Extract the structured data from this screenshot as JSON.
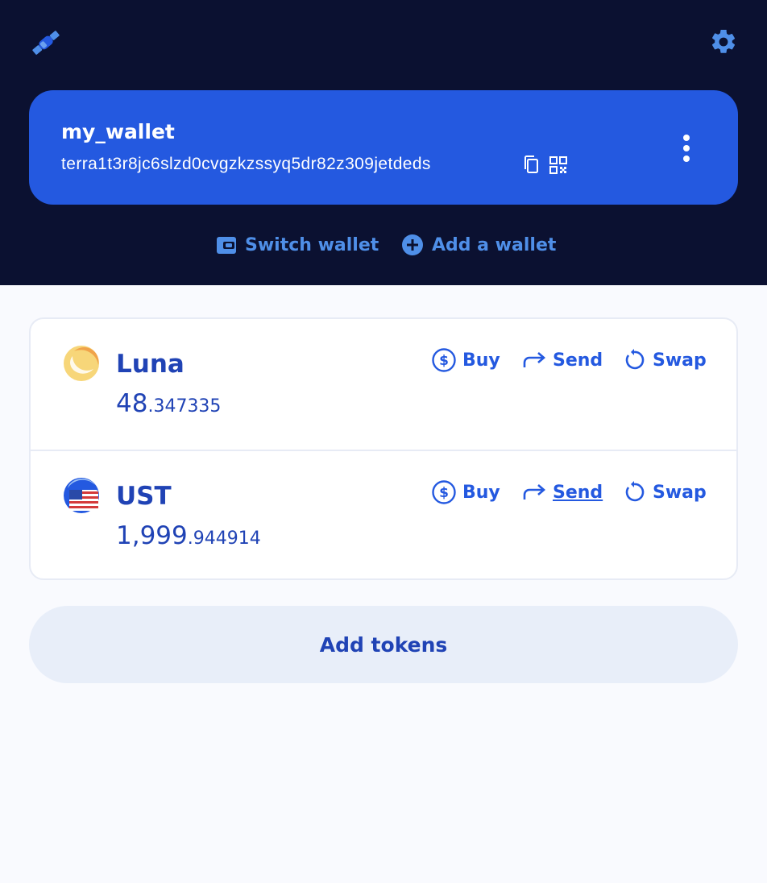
{
  "header": {
    "logo_icon": "satellite-icon",
    "settings_icon": "gear-icon"
  },
  "wallet": {
    "name": "my_wallet",
    "address": "terra1t3r8jc6slzd0cvgzkzssyq5dr82z309jetdeds",
    "actions": {
      "switch_label": "Switch wallet",
      "add_label": "Add a wallet"
    }
  },
  "assets": [
    {
      "symbol": "Luna",
      "amount_int": "48",
      "amount_dec": ".347335",
      "icon": "luna-token-icon",
      "actions": {
        "buy": "Buy",
        "send": "Send",
        "swap": "Swap"
      }
    },
    {
      "symbol": "UST",
      "amount_int": "1,999",
      "amount_dec": ".944914",
      "icon": "ust-token-icon",
      "actions": {
        "buy": "Buy",
        "send": "Send",
        "swap": "Swap"
      }
    }
  ],
  "add_tokens_label": "Add tokens",
  "colors": {
    "header_bg": "#0b1131",
    "card_bg": "#2459e0",
    "accent": "#2459e0",
    "text_primary": "#2043b5",
    "link_light": "#4f8fe8"
  }
}
